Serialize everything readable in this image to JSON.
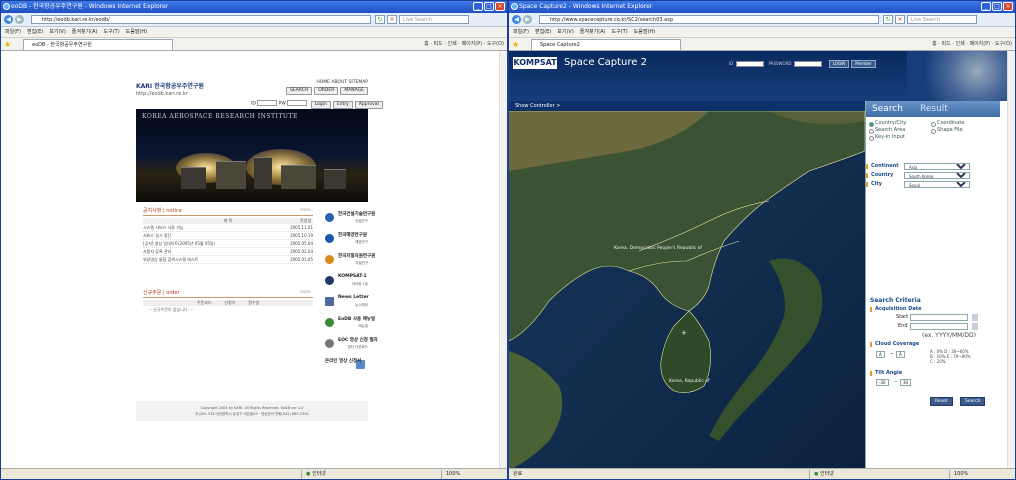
{
  "left": {
    "title": "eoDB - 한국항공우주연구원 - Windows Internet Explorer",
    "url": "http://eodb.kari.re.kr/eodb/",
    "search_placeholder": "Live Search",
    "menu": [
      "파일(F)",
      "편집(E)",
      "보기(V)",
      "즐겨찾기(A)",
      "도구(T)",
      "도움말(H)"
    ],
    "tab_label": "eoDB - 한국항공우주연구원",
    "tools": "홈 · 피드 · 인쇄 · 페이지(P) · 도구(O)",
    "status": "인터넷",
    "zoom": "100%",
    "site": {
      "logo": "KARI 한국항공우주연구원",
      "url": "http://eodb.kari.re.kr",
      "top_nav": "HOME  ABOUT  SITEMAP",
      "buttons": [
        "SEARCH",
        "ORDER",
        "MANAGE"
      ],
      "id_label": "ID",
      "pw_label": "PW",
      "auth_buttons": [
        "Login",
        "Entry",
        "Approval"
      ],
      "banner_title": "KOREA AEROSPACE RESEARCH INSTITUTE",
      "notice_title": "공지사항 | notice",
      "more": "more..",
      "notice_header": [
        "제 목",
        "작성일"
      ],
      "notices": [
        {
          "title": "시스템 서비스 사용 가능",
          "date": "2005.11.01"
        },
        {
          "title": "서비스 일시 중단",
          "date": "2005.10.19"
        },
        {
          "title": "[공지] 영상 업데이트(2005년 05월 05일)",
          "date": "2005.05.04"
        },
        {
          "title": "사용자 등록 관리",
          "date": "2005.02.04"
        },
        {
          "title": "위성영상 통합 검색시스템 테스트",
          "date": "2005.01.05"
        }
      ],
      "order_title": "신규주문 | order",
      "order_header": [
        "주문코드",
        "신청자",
        "접수일"
      ],
      "order_empty": "-- 신규주문이 없습니다. --",
      "side": [
        {
          "title": "한국건설기술연구원",
          "sub": "건설연구",
          "color": "#2860b0"
        },
        {
          "title": "한국해양연구원",
          "sub": "해양연구",
          "color": "#1a55a8"
        },
        {
          "title": "한국지질자원연구원",
          "sub": "지질연구",
          "color": "#d88a1a"
        },
        {
          "title": "KOMPSAT-1",
          "sub": "아리랑 1호",
          "color": "#223a6a"
        },
        {
          "title": "News Letter",
          "sub": "뉴스레터",
          "color": "#4a6aa0"
        },
        {
          "title": "EoDB 사용 매뉴얼",
          "sub": "매뉴얼",
          "color": "#3a8a3a"
        },
        {
          "title": "EOC 영상 신청 절차",
          "sub": "절차 다운로드",
          "color": "#777"
        },
        {
          "title": "온라인 영상 신청서",
          "sub": "",
          "color": "#5a8ac8"
        }
      ],
      "footer": "Copyright 2004 by KARI. All Rights Reserved. EoDB ver 1.0\n우)305-333 대전광역시 유성구 어은동45 · 영상관리 전화(042) 860-2301"
    }
  },
  "right": {
    "title": "Space Capture2 - Windows Internet Explorer",
    "url": "http://www.spacecapture.co.kr/SC2/search03.asp",
    "search_placeholder": "Live Search",
    "menu": [
      "파일(F)",
      "편집(E)",
      "보기(V)",
      "즐겨찾기(A)",
      "도구(T)",
      "도움말(H)"
    ],
    "tab_label": "Space Capture2",
    "tools": "홈 · 피드 · 인쇄 · 페이지(P) · 도구(O)",
    "status_left": "완료",
    "status": "인터넷",
    "zoom": "100%",
    "site": {
      "logo": "KOMPSAT",
      "title": "Space Capture 2",
      "id_label": "ID",
      "pw_label": "PASSWORD",
      "login": "LOGIN",
      "member": "Member",
      "show_controller": "Show Controller >",
      "map_labels": [
        "Korea, Democratic People's Republic of",
        "Korea, Republic of",
        "+"
      ],
      "tabs": [
        "Search",
        "Result"
      ],
      "radios": [
        "Country/City",
        "Coordinate",
        "Search Area",
        "Shape File",
        "Key-in Input"
      ],
      "fields": [
        {
          "label": "Continent",
          "value": "Asia"
        },
        {
          "label": "Country",
          "value": "South Korea"
        },
        {
          "label": "City",
          "value": "Seoul"
        }
      ],
      "criteria_title": "Search Criteria",
      "acq_date": "Acquisition Date",
      "start": "Start",
      "end": "End",
      "date_hint": "(ex. YYYY/MM/DD)",
      "cloud": "Cloud Coverage",
      "cloud_from": "A",
      "cloud_to": "A",
      "cloud_legend": [
        "A : 0%   D : 30~60%",
        "B : 10%  E : 70~90%",
        "C : 20%"
      ],
      "tilt": "Tilt Angle",
      "tilt_from": "-30",
      "tilt_to": "30",
      "reset": "Reset",
      "search": "Search"
    }
  }
}
